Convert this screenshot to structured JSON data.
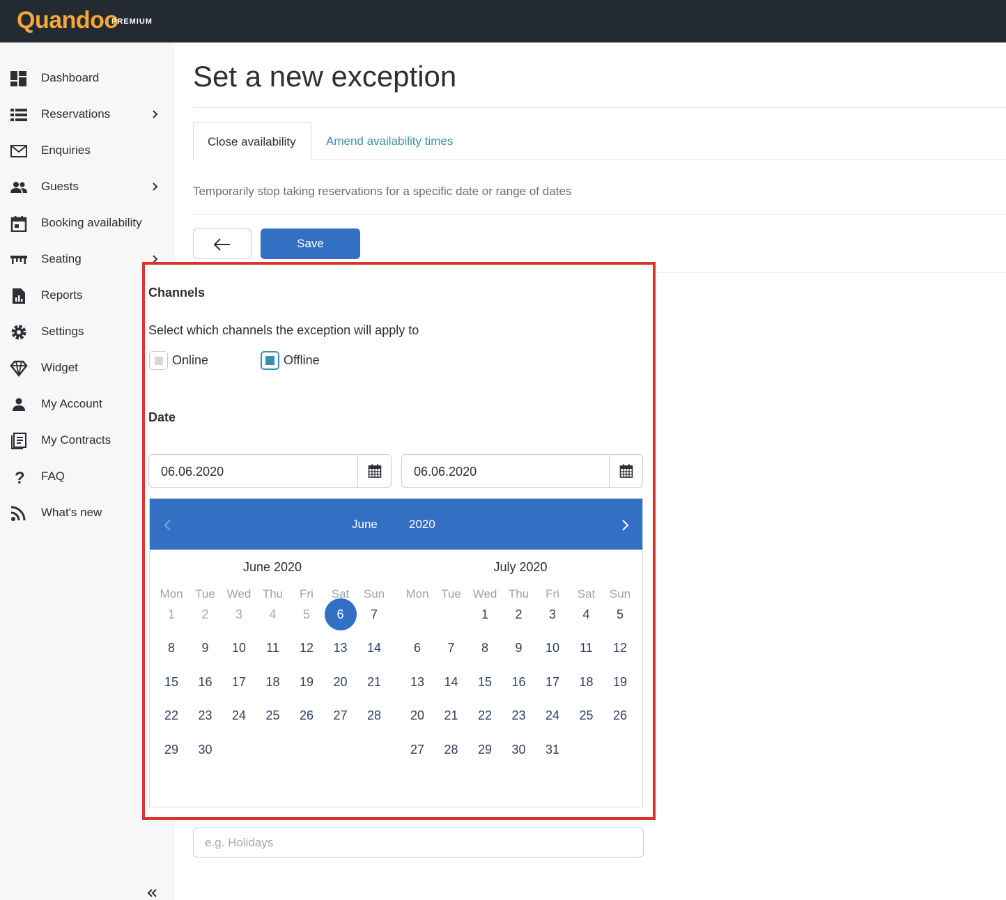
{
  "brand": {
    "name": "Quandoo",
    "badge": "PREMIUM",
    "color": "#f3a838"
  },
  "sidebar": {
    "items": [
      {
        "label": "Dashboard",
        "icon": "dashboard-icon",
        "has_submenu": false
      },
      {
        "label": "Reservations",
        "icon": "list-icon",
        "has_submenu": true
      },
      {
        "label": "Enquiries",
        "icon": "mail-icon",
        "has_submenu": false
      },
      {
        "label": "Guests",
        "icon": "people-icon",
        "has_submenu": true
      },
      {
        "label": "Booking availability",
        "icon": "calendar-icon",
        "has_submenu": false
      },
      {
        "label": "Seating",
        "icon": "table-icon",
        "has_submenu": true
      },
      {
        "label": "Reports",
        "icon": "report-icon",
        "has_submenu": false
      },
      {
        "label": "Settings",
        "icon": "gear-icon",
        "has_submenu": false
      },
      {
        "label": "Widget",
        "icon": "diamond-icon",
        "has_submenu": false
      },
      {
        "label": "My Account",
        "icon": "person-icon",
        "has_submenu": false
      },
      {
        "label": "My Contracts",
        "icon": "contract-icon",
        "has_submenu": false
      },
      {
        "label": "FAQ",
        "icon": "question-icon",
        "has_submenu": false
      },
      {
        "label": "What's new",
        "icon": "rss-icon",
        "has_submenu": false
      }
    ],
    "collapse_icon": "double-chevron-left-icon"
  },
  "main": {
    "title": "Set a new exception",
    "tabs": [
      {
        "label": "Close availability",
        "active": true
      },
      {
        "label": "Amend availability times",
        "active": false
      }
    ],
    "description": "Temporarily stop taking reservations for a specific date or range of dates",
    "back_icon": "arrow-left-icon",
    "save_label": "Save",
    "accent": "#336fc2"
  },
  "channels": {
    "title": "Channels",
    "description": "Select which channels the exception will apply to",
    "options": [
      {
        "label": "Online",
        "checked": false
      },
      {
        "label": "Offline",
        "checked": true
      }
    ]
  },
  "date": {
    "title": "Date",
    "start": "06.06.2020",
    "end": "06.06.2020"
  },
  "datepicker": {
    "header_month": "June",
    "header_year": "2020",
    "weekdays": [
      "Mon",
      "Tue",
      "Wed",
      "Thu",
      "Fri",
      "Sat",
      "Sun"
    ],
    "months": [
      {
        "title": "June 2020",
        "first_weekday": 0,
        "days": 30,
        "selected": 6,
        "past_before": 6
      },
      {
        "title": "July 2020",
        "first_weekday": 2,
        "days": 31,
        "selected": null,
        "past_before": 0
      }
    ]
  },
  "reason": {
    "placeholder": "e.g. Holidays",
    "value": ""
  },
  "highlight_color": "#d9352a"
}
